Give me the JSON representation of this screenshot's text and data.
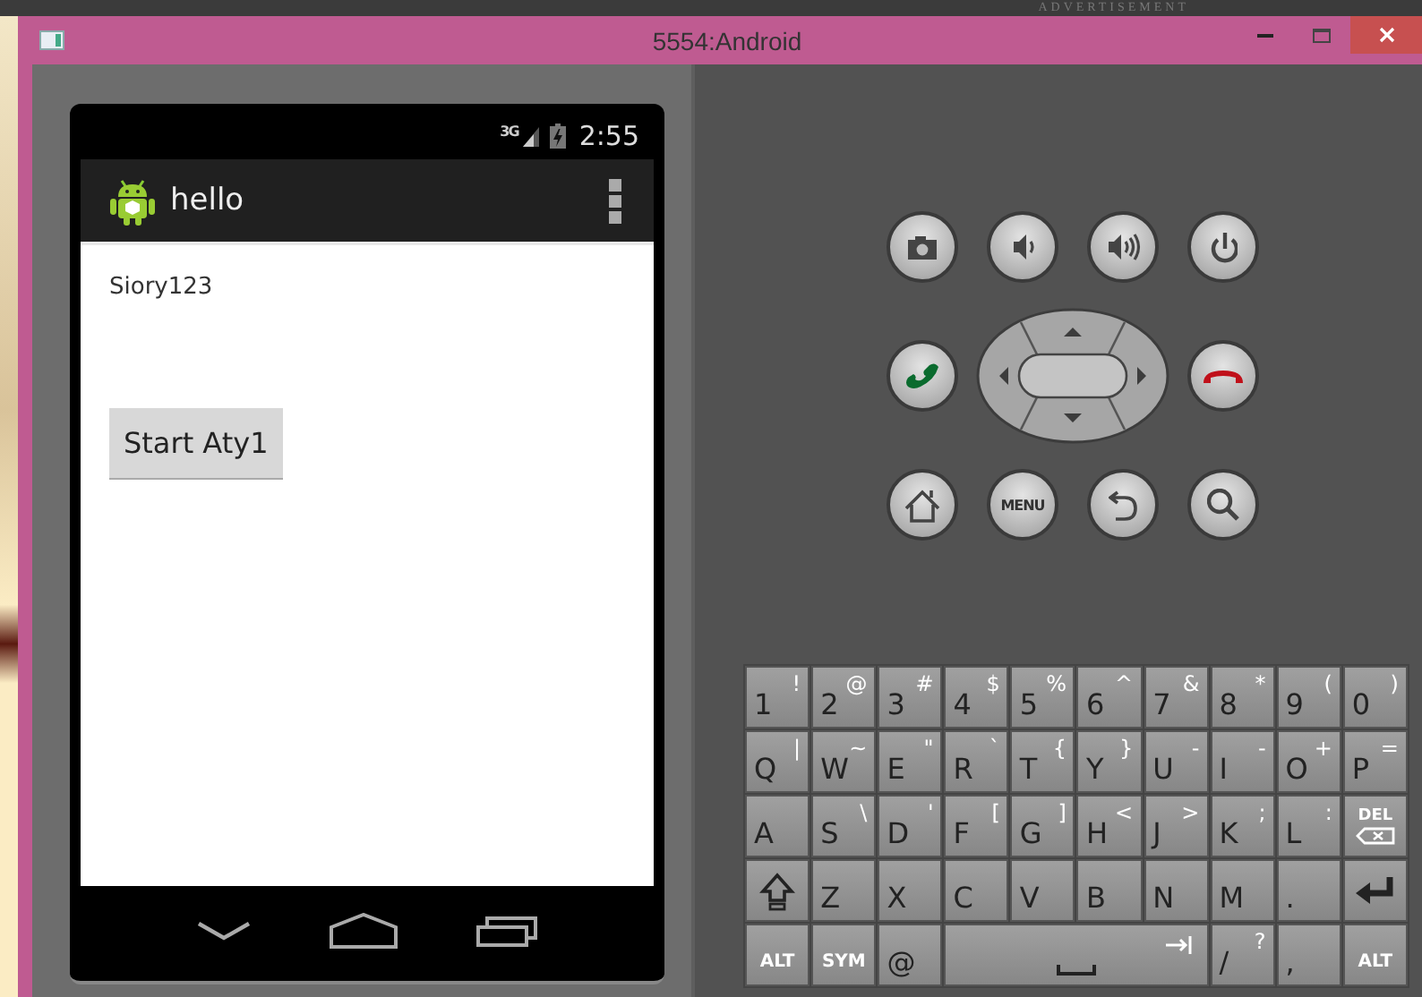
{
  "backdrop": {
    "text": "ADVERTISEMENT"
  },
  "window": {
    "title": "5554:Android"
  },
  "phone": {
    "status_bar": {
      "time": "2:55",
      "network": "3G"
    },
    "action_bar": {
      "title": "hello"
    },
    "content": {
      "text": "Siory123",
      "button": "Start Aty1"
    }
  },
  "hardware_buttons": [
    {
      "kind": "camera"
    },
    {
      "kind": "volume-down"
    },
    {
      "kind": "volume-up"
    },
    {
      "kind": "power"
    },
    {
      "kind": "call"
    },
    {
      "kind": "dpad"
    },
    {
      "kind": "end-call"
    },
    {
      "kind": "home"
    },
    {
      "kind": "menu",
      "label": "MENU"
    },
    {
      "kind": "back"
    },
    {
      "kind": "search"
    }
  ],
  "keyboard": [
    [
      {
        "main": "1",
        "alt": "!"
      },
      {
        "main": "2",
        "alt": "@"
      },
      {
        "main": "3",
        "alt": "#"
      },
      {
        "main": "4",
        "alt": "$"
      },
      {
        "main": "5",
        "alt": "%"
      },
      {
        "main": "6",
        "alt": "^"
      },
      {
        "main": "7",
        "alt": "&"
      },
      {
        "main": "8",
        "alt": "*"
      },
      {
        "main": "9",
        "alt": "("
      },
      {
        "main": "0",
        "alt": ")"
      }
    ],
    [
      {
        "main": "Q",
        "alt": "|"
      },
      {
        "main": "W",
        "alt": "~"
      },
      {
        "main": "E",
        "alt": "\""
      },
      {
        "main": "R",
        "alt": "`"
      },
      {
        "main": "T",
        "alt": "{"
      },
      {
        "main": "Y",
        "alt": "}"
      },
      {
        "main": "U",
        "alt": "-"
      },
      {
        "main": "I",
        "alt": "-"
      },
      {
        "main": "O",
        "alt": "+"
      },
      {
        "main": "P",
        "alt": "="
      }
    ],
    [
      {
        "main": "A"
      },
      {
        "main": "S",
        "alt": "\\"
      },
      {
        "main": "D",
        "alt": "'"
      },
      {
        "main": "F",
        "alt": "["
      },
      {
        "main": "G",
        "alt": "]"
      },
      {
        "main": "H",
        "alt": "<"
      },
      {
        "main": "J",
        "alt": ">"
      },
      {
        "main": "K",
        "alt": ";"
      },
      {
        "main": "L",
        "alt": ":"
      },
      {
        "kind": "delete",
        "main": "DEL"
      }
    ],
    [
      {
        "kind": "shift"
      },
      {
        "main": "Z"
      },
      {
        "main": "X"
      },
      {
        "main": "C"
      },
      {
        "main": "V"
      },
      {
        "main": "B"
      },
      {
        "main": "N"
      },
      {
        "main": "M"
      },
      {
        "main": "."
      },
      {
        "kind": "enter"
      }
    ],
    [
      {
        "kind": "small",
        "main": "ALT"
      },
      {
        "kind": "small",
        "main": "SYM"
      },
      {
        "main": "@"
      },
      {
        "kind": "space"
      },
      {
        "main": "/",
        "alt": "?"
      },
      {
        "main": ","
      },
      {
        "kind": "small",
        "main": "ALT"
      }
    ]
  ]
}
